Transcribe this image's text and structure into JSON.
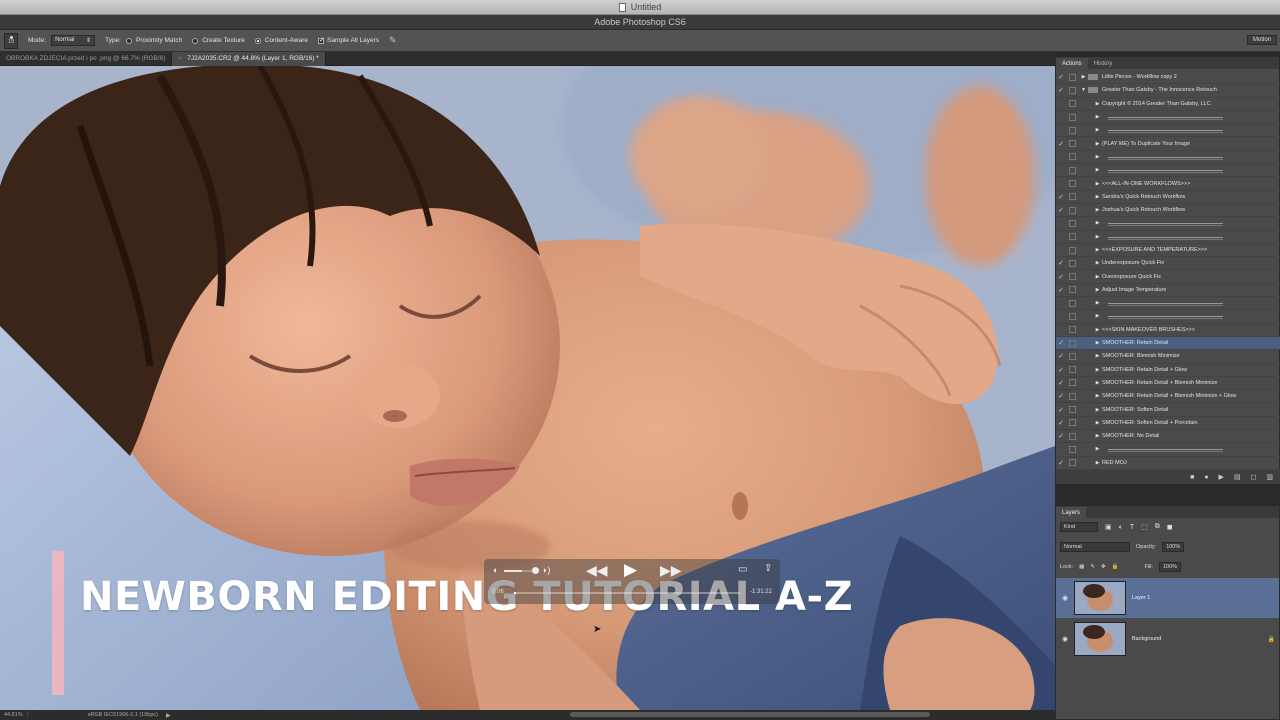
{
  "window": {
    "title": "Untitled",
    "app_name": "Adobe Photoshop CS6"
  },
  "options_bar": {
    "brush_size": "19",
    "mode_label": "Mode:",
    "mode_value": "Normal",
    "type_label": "Type:",
    "type_options": [
      {
        "label": "Proximity Match",
        "selected": false
      },
      {
        "label": "Create Texture",
        "selected": false
      },
      {
        "label": "Content-Aware",
        "selected": true
      }
    ],
    "sample_all_layers": {
      "label": "Sample All Layers",
      "checked": true
    },
    "workspace_button": "Motion"
  },
  "document_tabs": [
    {
      "label": "OBROBKA ZDJECIA przed i po .png @ 66.7% (RGB/8)",
      "active": false
    },
    {
      "label": "7J2A2035.CR2 @ 44.8% (Layer 1, RGB/16) *",
      "active": true
    }
  ],
  "overlay": {
    "title": "NEWBORN EDITING TUTORIAL A-Z",
    "accent_color": "#f3b6c0"
  },
  "media_controls": {
    "volume_level": 0.55,
    "progress": 0.01,
    "elapsed": "0:06",
    "remaining": "-1:31:22"
  },
  "status_bar": {
    "zoom": "44.81%",
    "profile": "sRGB IEC61966-2.1 (16bpc)"
  },
  "actions_panel": {
    "tabs": [
      "Actions",
      "History"
    ],
    "rows": [
      {
        "label": "Little Pieces - Workflow copy 2",
        "checked": true,
        "dialog": true,
        "kind": "folder",
        "expanded": false,
        "separator": false,
        "selected": false
      },
      {
        "label": "Greater Than Gatsby - The Innocence Retouch",
        "checked": true,
        "dialog": true,
        "kind": "folder",
        "expanded": true,
        "separator": false,
        "selected": false
      },
      {
        "label": "Copyright © 2014 Greater Than Gatsby, LLC",
        "checked": false,
        "dialog": false,
        "kind": "action",
        "separator": false,
        "selected": false
      },
      {
        "label": "",
        "checked": false,
        "dialog": false,
        "kind": "action",
        "separator": true,
        "selected": false
      },
      {
        "label": "",
        "checked": false,
        "dialog": false,
        "kind": "action",
        "separator": true,
        "selected": false
      },
      {
        "label": "(PLAY ME) To Duplicate Your Image",
        "checked": true,
        "dialog": true,
        "kind": "action",
        "separator": false,
        "selected": false
      },
      {
        "label": "",
        "checked": false,
        "dialog": false,
        "kind": "action",
        "separator": true,
        "selected": false
      },
      {
        "label": "",
        "checked": false,
        "dialog": false,
        "kind": "action",
        "separator": true,
        "selected": false
      },
      {
        "label": "<<<ALL-IN-ONE WORKFLOWS>>>",
        "checked": false,
        "dialog": false,
        "kind": "action",
        "separator": false,
        "selected": false
      },
      {
        "label": "Sandra's Quick Retouch Workflow",
        "checked": true,
        "dialog": true,
        "kind": "action",
        "separator": false,
        "selected": false
      },
      {
        "label": "Joshua's Quick Retouch Workflow",
        "checked": true,
        "dialog": true,
        "kind": "action",
        "separator": false,
        "selected": false
      },
      {
        "label": "",
        "checked": false,
        "dialog": false,
        "kind": "action",
        "separator": true,
        "selected": false
      },
      {
        "label": "",
        "checked": false,
        "dialog": false,
        "kind": "action",
        "separator": true,
        "selected": false
      },
      {
        "label": "<<<EXPOSURE AND TEMPERATURE>>>",
        "checked": false,
        "dialog": false,
        "kind": "action",
        "separator": false,
        "selected": false
      },
      {
        "label": "Underexposure Quick Fix",
        "checked": true,
        "dialog": true,
        "kind": "action",
        "separator": false,
        "selected": false
      },
      {
        "label": "Overexposure Quick Fix",
        "checked": true,
        "dialog": true,
        "kind": "action",
        "separator": false,
        "selected": false
      },
      {
        "label": "Adjust Image Temperature",
        "checked": true,
        "dialog": true,
        "kind": "action",
        "separator": false,
        "selected": false
      },
      {
        "label": "",
        "checked": false,
        "dialog": false,
        "kind": "action",
        "separator": true,
        "selected": false
      },
      {
        "label": "",
        "checked": false,
        "dialog": false,
        "kind": "action",
        "separator": true,
        "selected": false
      },
      {
        "label": "<<<SKIN MAKEOVER BRUSHES>>>",
        "checked": false,
        "dialog": false,
        "kind": "action",
        "separator": false,
        "selected": false
      },
      {
        "label": "SMOOTHER: Retain Detail",
        "checked": true,
        "dialog": true,
        "kind": "action",
        "separator": false,
        "selected": true
      },
      {
        "label": "SMOOTHER: Blemish Minimize",
        "checked": true,
        "dialog": true,
        "kind": "action",
        "separator": false,
        "selected": false
      },
      {
        "label": "SMOOTHER: Retain Detail + Glow",
        "checked": true,
        "dialog": true,
        "kind": "action",
        "separator": false,
        "selected": false
      },
      {
        "label": "SMOOTHER: Retain Detail + Blemish Minimize",
        "checked": true,
        "dialog": true,
        "kind": "action",
        "separator": false,
        "selected": false
      },
      {
        "label": "SMOOTHER: Retain Detail + Blemish Minimize + Glow",
        "checked": true,
        "dialog": true,
        "kind": "action",
        "separator": false,
        "selected": false
      },
      {
        "label": "SMOOTHER: Soften Detail",
        "checked": true,
        "dialog": true,
        "kind": "action",
        "separator": false,
        "selected": false
      },
      {
        "label": "SMOOTHER: Soften Detail + Porcelain",
        "checked": true,
        "dialog": true,
        "kind": "action",
        "separator": false,
        "selected": false
      },
      {
        "label": "SMOOTHER: No Detail",
        "checked": true,
        "dialog": true,
        "kind": "action",
        "separator": false,
        "selected": false
      },
      {
        "label": "",
        "checked": false,
        "dialog": false,
        "kind": "action",
        "separator": true,
        "selected": false
      },
      {
        "label": "RED MOJ",
        "checked": true,
        "dialog": true,
        "kind": "action",
        "separator": false,
        "selected": false
      }
    ]
  },
  "layers_panel": {
    "tab": "Layers",
    "kind_filter": "Kind",
    "blend_mode": "Normal",
    "opacity_label": "Opacity:",
    "opacity": "100%",
    "lock_label": "Lock:",
    "fill_label": "Fill:",
    "fill": "100%",
    "layers": [
      {
        "name": "Layer 1",
        "selected": true,
        "visible": true,
        "locked": false
      },
      {
        "name": "Background",
        "selected": false,
        "visible": true,
        "locked": true
      }
    ]
  },
  "icons": {
    "close": "×",
    "eye": "👁",
    "play": "▶",
    "rewind": "◀◀",
    "fast_forward": "▶▶",
    "volume": "🔈",
    "share": "⇪",
    "screen": "▭",
    "lock": "🔒",
    "brush": "✎"
  }
}
